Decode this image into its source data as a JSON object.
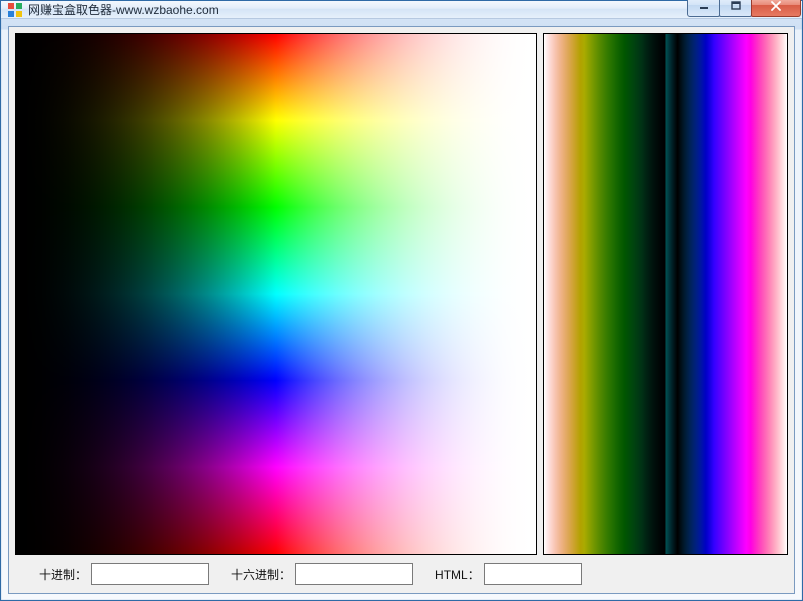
{
  "window": {
    "title": "网赚宝盒取色器-www.wzbaohe.com"
  },
  "labels": {
    "decimal": "十进制：",
    "hex": "十六进制：",
    "html": "HTML："
  },
  "fields": {
    "decimal_value": "",
    "hex_value": "",
    "html_value": ""
  },
  "icons": {
    "app": "app-icon",
    "minimize": "minimize-icon",
    "maximize": "maximize-icon",
    "close": "close-icon"
  }
}
